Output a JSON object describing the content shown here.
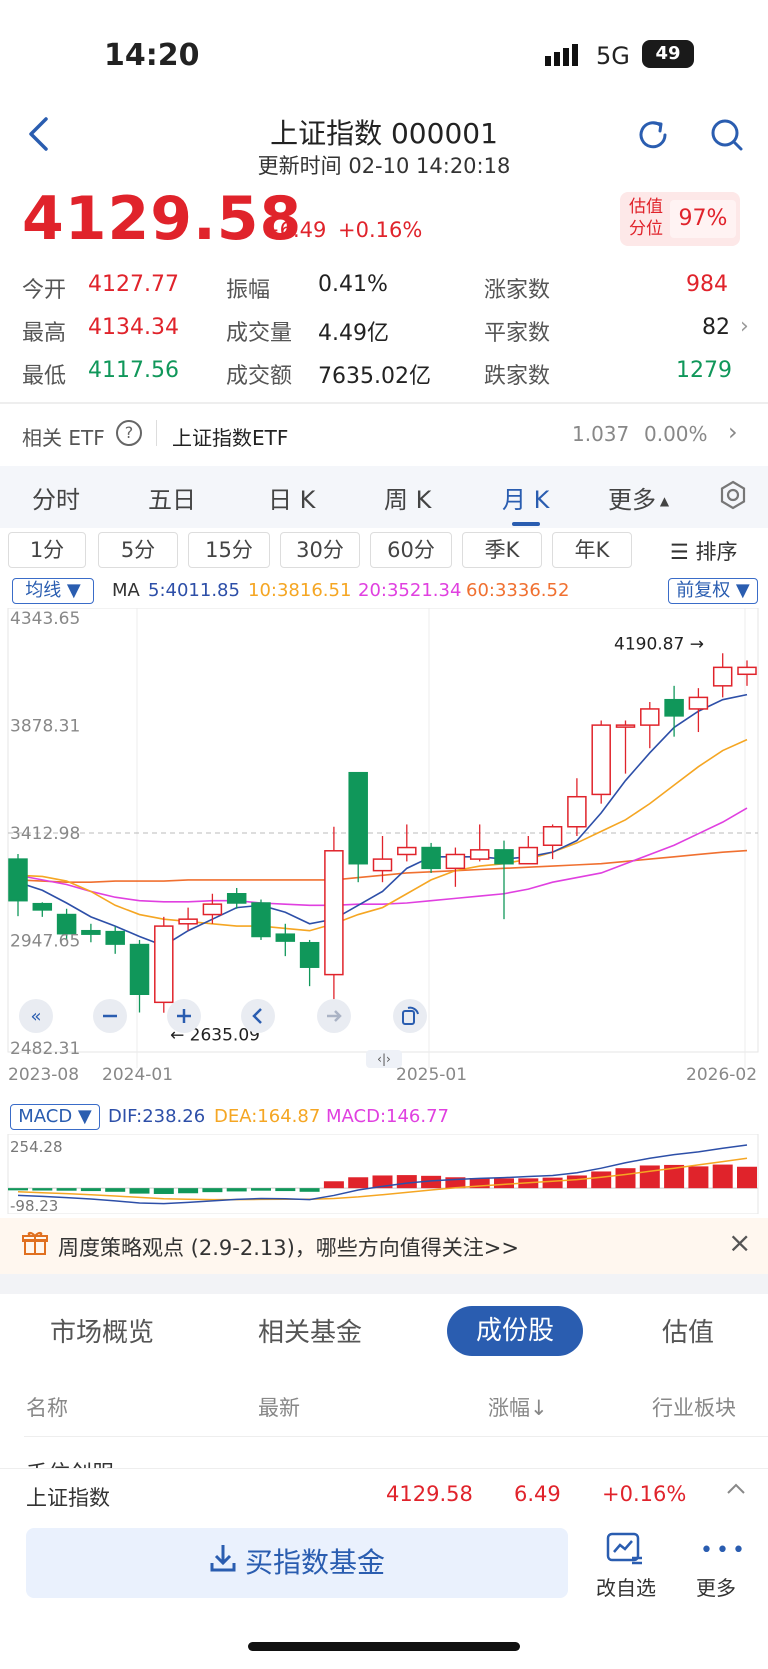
{
  "status": {
    "time": "14:20",
    "network": "5G",
    "battery": "49"
  },
  "header": {
    "title": "上证指数 000001",
    "update": "更新时间 02-10 14:20:18"
  },
  "quote": {
    "price": "4129.58",
    "change": "+6.49",
    "change_pct": "+0.16%",
    "valuation_label_1": "估值",
    "valuation_label_2": "分位",
    "valuation_pct": "97%"
  },
  "stats": {
    "open_label": "今开",
    "open": "4127.77",
    "high_label": "最高",
    "high": "4134.34",
    "low_label": "最低",
    "low": "4117.56",
    "amplitude_label": "振幅",
    "amplitude": "0.41%",
    "volume_label": "成交量",
    "volume": "4.49亿",
    "turnover_label": "成交额",
    "turnover": "7635.02亿",
    "up_label": "涨家数",
    "up": "984",
    "flat_label": "平家数",
    "flat": "82",
    "down_label": "跌家数",
    "down": "1279"
  },
  "etf": {
    "label": "相关 ETF",
    "name": "上证指数ETF",
    "value": "1.037",
    "pct": "0.00%"
  },
  "period_tabs": [
    "分时",
    "五日",
    "日 K",
    "周 K",
    "月 K",
    "更多"
  ],
  "minute_tabs": [
    "1分",
    "5分",
    "15分",
    "30分",
    "60分",
    "季K",
    "年K"
  ],
  "sort_label": "排序",
  "legend": {
    "ma_select": "均线",
    "ma_prefix": "MA",
    "ma5": "5:4011.85",
    "ma10": "10:3816.51",
    "ma20": "20:3521.34",
    "ma60": "60:3336.52",
    "adjust": "前复权"
  },
  "macd": {
    "select": "MACD",
    "dif": "DIF:238.26",
    "dea": "DEA:164.87",
    "macd": "MACD:146.77",
    "top": "254.28",
    "bottom": "-98.23"
  },
  "chart_data": {
    "type": "candlestick",
    "y_ticks": [
      "4343.65",
      "3878.31",
      "3412.98",
      "2947.65",
      "2482.31"
    ],
    "x_ticks": [
      "2023-08",
      "2024-01",
      "2025-01",
      "2026-02"
    ],
    "max_label": "4190.87",
    "min_label": "2635.09",
    "ylim": [
      2482.31,
      4343.65
    ],
    "candles": [
      {
        "o": 3300,
        "h": 3322,
        "l": 3053,
        "c": 3120
      },
      {
        "o": 3107,
        "h": 3113,
        "l": 3050,
        "c": 3080
      },
      {
        "o": 3060,
        "h": 3085,
        "l": 2953,
        "c": 2977
      },
      {
        "o": 2990,
        "h": 3020,
        "l": 2940,
        "c": 2975
      },
      {
        "o": 2986,
        "h": 3008,
        "l": 2890,
        "c": 2932
      },
      {
        "o": 2930,
        "h": 2950,
        "l": 2636,
        "c": 2715
      },
      {
        "o": 2680,
        "h": 3050,
        "l": 2635,
        "c": 3010
      },
      {
        "o": 3020,
        "h": 3090,
        "l": 2990,
        "c": 3040
      },
      {
        "o": 3060,
        "h": 3150,
        "l": 3020,
        "c": 3105
      },
      {
        "o": 3150,
        "h": 3175,
        "l": 3085,
        "c": 3110
      },
      {
        "o": 3110,
        "h": 3125,
        "l": 2950,
        "c": 2965
      },
      {
        "o": 2975,
        "h": 3020,
        "l": 2880,
        "c": 2945
      },
      {
        "o": 2938,
        "h": 2950,
        "l": 2750,
        "c": 2832
      },
      {
        "o": 2800,
        "h": 3440,
        "l": 2690,
        "c": 3336
      },
      {
        "o": 3674,
        "h": 3674,
        "l": 3200,
        "c": 3280
      },
      {
        "o": 3250,
        "h": 3400,
        "l": 3200,
        "c": 3300
      },
      {
        "o": 3320,
        "h": 3450,
        "l": 3290,
        "c": 3350
      },
      {
        "o": 3350,
        "h": 3370,
        "l": 3240,
        "c": 3260
      },
      {
        "o": 3260,
        "h": 3350,
        "l": 3180,
        "c": 3320
      },
      {
        "o": 3300,
        "h": 3450,
        "l": 3290,
        "c": 3340
      },
      {
        "o": 3340,
        "h": 3380,
        "l": 3040,
        "c": 3280
      },
      {
        "o": 3280,
        "h": 3400,
        "l": 3290,
        "c": 3350
      },
      {
        "o": 3360,
        "h": 3450,
        "l": 3300,
        "c": 3440
      },
      {
        "o": 3440,
        "h": 3650,
        "l": 3400,
        "c": 3570
      },
      {
        "o": 3580,
        "h": 3900,
        "l": 3540,
        "c": 3880
      },
      {
        "o": 3880,
        "h": 3900,
        "l": 3670,
        "c": 3880
      },
      {
        "o": 3880,
        "h": 3980,
        "l": 3780,
        "c": 3950
      },
      {
        "o": 3990,
        "h": 4050,
        "l": 3830,
        "c": 3920
      },
      {
        "o": 3950,
        "h": 4040,
        "l": 3850,
        "c": 4000
      },
      {
        "o": 4050,
        "h": 4191,
        "l": 4000,
        "c": 4130
      },
      {
        "o": 4100,
        "h": 4160,
        "l": 4050,
        "c": 4130
      }
    ],
    "ma5": [
      3200,
      3165,
      3110,
      3050,
      3010,
      2965,
      2925,
      2990,
      3040,
      3090,
      3100,
      3070,
      3020,
      3040,
      3100,
      3160,
      3260,
      3310,
      3310,
      3310,
      3300,
      3310,
      3330,
      3380,
      3500,
      3640,
      3760,
      3870,
      3940,
      3990,
      4012
    ],
    "ma10": [
      3230,
      3225,
      3205,
      3160,
      3100,
      3060,
      3040,
      3030,
      3020,
      3010,
      3010,
      3000,
      2990,
      3020,
      3060,
      3090,
      3150,
      3210,
      3250,
      3270,
      3280,
      3300,
      3330,
      3370,
      3420,
      3470,
      3540,
      3620,
      3700,
      3770,
      3817
    ],
    "ma20": [
      3230,
      3210,
      3190,
      3160,
      3135,
      3120,
      3115,
      3115,
      3120,
      3120,
      3110,
      3105,
      3100,
      3100,
      3105,
      3105,
      3110,
      3120,
      3130,
      3140,
      3150,
      3170,
      3200,
      3220,
      3240,
      3280,
      3320,
      3360,
      3410,
      3460,
      3521
    ],
    "ma60": [
      3210,
      3205,
      3200,
      3200,
      3205,
      3205,
      3205,
      3210,
      3210,
      3210,
      3210,
      3210,
      3210,
      3210,
      3220,
      3230,
      3240,
      3245,
      3250,
      3255,
      3260,
      3265,
      3270,
      3275,
      3280,
      3290,
      3300,
      3310,
      3320,
      3330,
      3337
    ],
    "macd_hist": [
      -12,
      -13,
      -14,
      -16,
      -20,
      -30,
      -32,
      -28,
      -22,
      -18,
      -14,
      -16,
      -20,
      38,
      60,
      70,
      72,
      68,
      60,
      56,
      54,
      54,
      58,
      70,
      92,
      110,
      125,
      128,
      120,
      130,
      118
    ],
    "dif": [
      -40,
      -45,
      -52,
      -60,
      -70,
      -82,
      -85,
      -78,
      -70,
      -62,
      -57,
      -58,
      -63,
      -40,
      -10,
      10,
      28,
      40,
      48,
      54,
      58,
      64,
      70,
      85,
      110,
      140,
      165,
      185,
      200,
      220,
      238
    ],
    "dea": [
      -20,
      -25,
      -30,
      -36,
      -43,
      -51,
      -58,
      -61,
      -63,
      -63,
      -62,
      -61,
      -61,
      -57,
      -48,
      -36,
      -23,
      -10,
      2,
      12,
      21,
      30,
      38,
      47,
      60,
      75,
      93,
      110,
      128,
      146,
      165
    ]
  },
  "banner": {
    "text": "周度策略观点 (2.9-2.13)，哪些方向值得关注>>"
  },
  "section_tabs": [
    "市场概览",
    "相关基金",
    "成份股",
    "估值"
  ],
  "columns": [
    "名称",
    "最新",
    "涨幅↓",
    "行业板块"
  ],
  "cut_row": "千住创服",
  "sticky": {
    "name": "上证指数",
    "price": "4129.58",
    "change": "6.49",
    "pct": "+0.16%"
  },
  "bottom": {
    "buy": "买指数基金",
    "watch": "改自选",
    "more": "更多"
  },
  "colors": {
    "up": "#e0232b",
    "down": "#10975a",
    "accent": "#2a5db0",
    "ma5": "#2d4fa8",
    "ma10": "#f5a623",
    "ma20": "#e040e0",
    "ma60": "#f07030"
  }
}
